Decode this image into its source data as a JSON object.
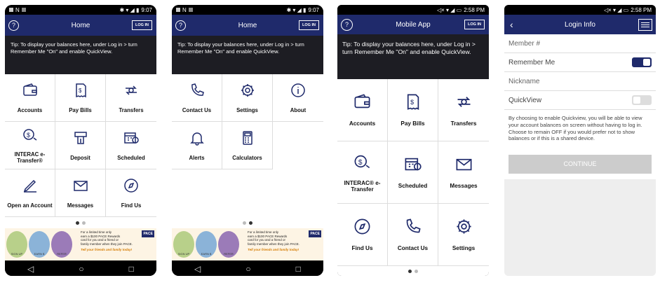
{
  "phone1": {
    "time": "9:07",
    "title": "Home",
    "login": "LOG IN",
    "tip": "Tip: To display your balances here, under Log in > turn Remember Me \"On\" and enable QuickView.",
    "tiles": [
      {
        "icon": "wallet-icon",
        "label": "Accounts"
      },
      {
        "icon": "bill-icon",
        "label": "Pay Bills"
      },
      {
        "icon": "transfer-icon",
        "label": "Transfers"
      },
      {
        "icon": "etransfer-icon",
        "label": "INTERAC e-Transfer®"
      },
      {
        "icon": "deposit-icon",
        "label": "Deposit"
      },
      {
        "icon": "scheduled-icon",
        "label": "Scheduled"
      },
      {
        "icon": "pen-icon",
        "label": "Open an Account"
      },
      {
        "icon": "envelope-icon",
        "label": "Messages"
      },
      {
        "icon": "compass-icon",
        "label": "Find Us"
      }
    ]
  },
  "phone2": {
    "time": "9:07",
    "title": "Home",
    "login": "LOG IN",
    "tip": "Tip: To display your balances here, under Log in > turn Remember Me \"On\" and enable QuickView.",
    "tiles": [
      {
        "icon": "phone-icon",
        "label": "Contact Us"
      },
      {
        "icon": "gear-icon",
        "label": "Settings"
      },
      {
        "icon": "info-icon",
        "label": "About"
      },
      {
        "icon": "bell-icon",
        "label": "Alerts"
      },
      {
        "icon": "calculator-icon",
        "label": "Calculators"
      }
    ]
  },
  "phone3": {
    "time": "2:58 PM",
    "title": "Mobile App",
    "login": "LOG IN",
    "tip": "Tip: To display your balances here, under Log in > turn Remember Me \"On\" and enable QuickView.",
    "tiles": [
      {
        "icon": "wallet-icon",
        "label": "Accounts"
      },
      {
        "icon": "bill-icon",
        "label": "Pay Bills"
      },
      {
        "icon": "transfer-icon",
        "label": "Transfers"
      },
      {
        "icon": "etransfer-icon",
        "label": "INTERAC® e-Transfer"
      },
      {
        "icon": "scheduled-icon",
        "label": "Scheduled"
      },
      {
        "icon": "envelope-icon",
        "label": "Messages"
      },
      {
        "icon": "compass-icon",
        "label": "Find Us"
      },
      {
        "icon": "phone-icon",
        "label": "Contact Us"
      },
      {
        "icon": "gear-icon",
        "label": "Settings"
      }
    ]
  },
  "phone4": {
    "time": "2:58 PM",
    "title": "Login Info",
    "member_placeholder": "Member #",
    "remember": "Remember Me",
    "remember_on": true,
    "nickname_placeholder": "Nickname",
    "quickview": "QuickView",
    "quickview_on": false,
    "note": "By choosing to enable Quickview, you will be able to view your account balances on screen without having to log in. Choose to remain OFF if you would prefer not to show balances or if this is a shared device.",
    "continue": "CONTINUE"
  },
  "banner": {
    "line1": "For a limited time only",
    "line2": "earn a $100 PACE Rewards",
    "line3": "card for you and a friend or",
    "line4": "family member when they join PACE.",
    "tagline": "Tell your friends and family today!",
    "logo": "PACE",
    "steps": [
      "SIGN UP",
      "EARN $",
      "REFER"
    ]
  },
  "nav": {
    "back": "◁",
    "home": "○",
    "recent": "□"
  },
  "colors": {
    "brand": "#1f2a6b",
    "tip_bg": "#1d1d23"
  }
}
